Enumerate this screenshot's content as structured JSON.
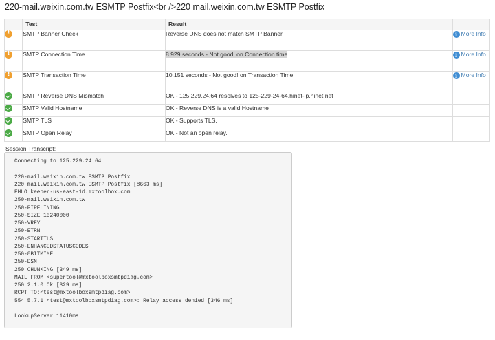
{
  "page_title": "220-mail.weixin.com.tw ESMTP Postfix<br />220 mail.weixin.com.tw ESMTP Postfix",
  "table": {
    "headers": {
      "test": "Test",
      "result": "Result"
    },
    "more_info_label": "More Info",
    "rows": [
      {
        "status": "warning",
        "status_icon": "warning-icon",
        "test": "SMTP Banner Check",
        "result": "Reverse DNS does not match SMTP Banner",
        "more_info": true
      },
      {
        "status": "warning",
        "status_icon": "warning-icon",
        "test": "SMTP Connection Time",
        "result": "8.929 seconds - Not good! on Connection time",
        "more_info": true,
        "highlighted": true
      },
      {
        "status": "warning",
        "status_icon": "warning-icon",
        "test": "SMTP Transaction Time",
        "result": "10.151 seconds - Not good! on Transaction Time",
        "more_info": true
      },
      {
        "status": "ok",
        "status_icon": "check-icon",
        "test": "SMTP Reverse DNS Mismatch",
        "result": "OK - 125.229.24.64 resolves to 125-229-24-64.hinet-ip.hinet.net",
        "more_info": false
      },
      {
        "status": "ok",
        "status_icon": "check-icon",
        "test": "SMTP Valid Hostname",
        "result": "OK - Reverse DNS is a valid Hostname",
        "more_info": false
      },
      {
        "status": "ok",
        "status_icon": "check-icon",
        "test": "SMTP TLS",
        "result": "OK - Supports TLS.",
        "more_info": false
      },
      {
        "status": "ok",
        "status_icon": "check-icon",
        "test": "SMTP Open Relay",
        "result": "OK - Not an open relay.",
        "more_info": false
      }
    ]
  },
  "colors": {
    "warning": "#f0a030",
    "ok": "#4caa47",
    "info": "#3f8dd3",
    "link": "#3a78b0"
  },
  "transcript": {
    "label": "Session Transcript:",
    "lines": [
      "Connecting to 125.229.24.64",
      "",
      "220-mail.weixin.com.tw ESMTP Postfix",
      "220 mail.weixin.com.tw ESMTP Postfix [8663 ms]",
      "EHLO keeper-us-east-1d.mxtoolbox.com",
      "250-mail.weixin.com.tw",
      "250-PIPELINING",
      "250-SIZE 10240000",
      "250-VRFY",
      "250-ETRN",
      "250-STARTTLS",
      "250-ENHANCEDSTATUSCODES",
      "250-8BITMIME",
      "250-DSN",
      "250 CHUNKING [349 ms]",
      "MAIL FROM:<supertool@mxtoolboxsmtpdiag.com>",
      "250 2.1.0 Ok [329 ms]",
      "RCPT TO:<test@mxtoolboxsmtpdiag.com>",
      "554 5.7.1 <test@mxtoolboxsmtpdiag.com>: Relay access denied [346 ms]",
      "",
      "LookupServer 11410ms"
    ]
  }
}
